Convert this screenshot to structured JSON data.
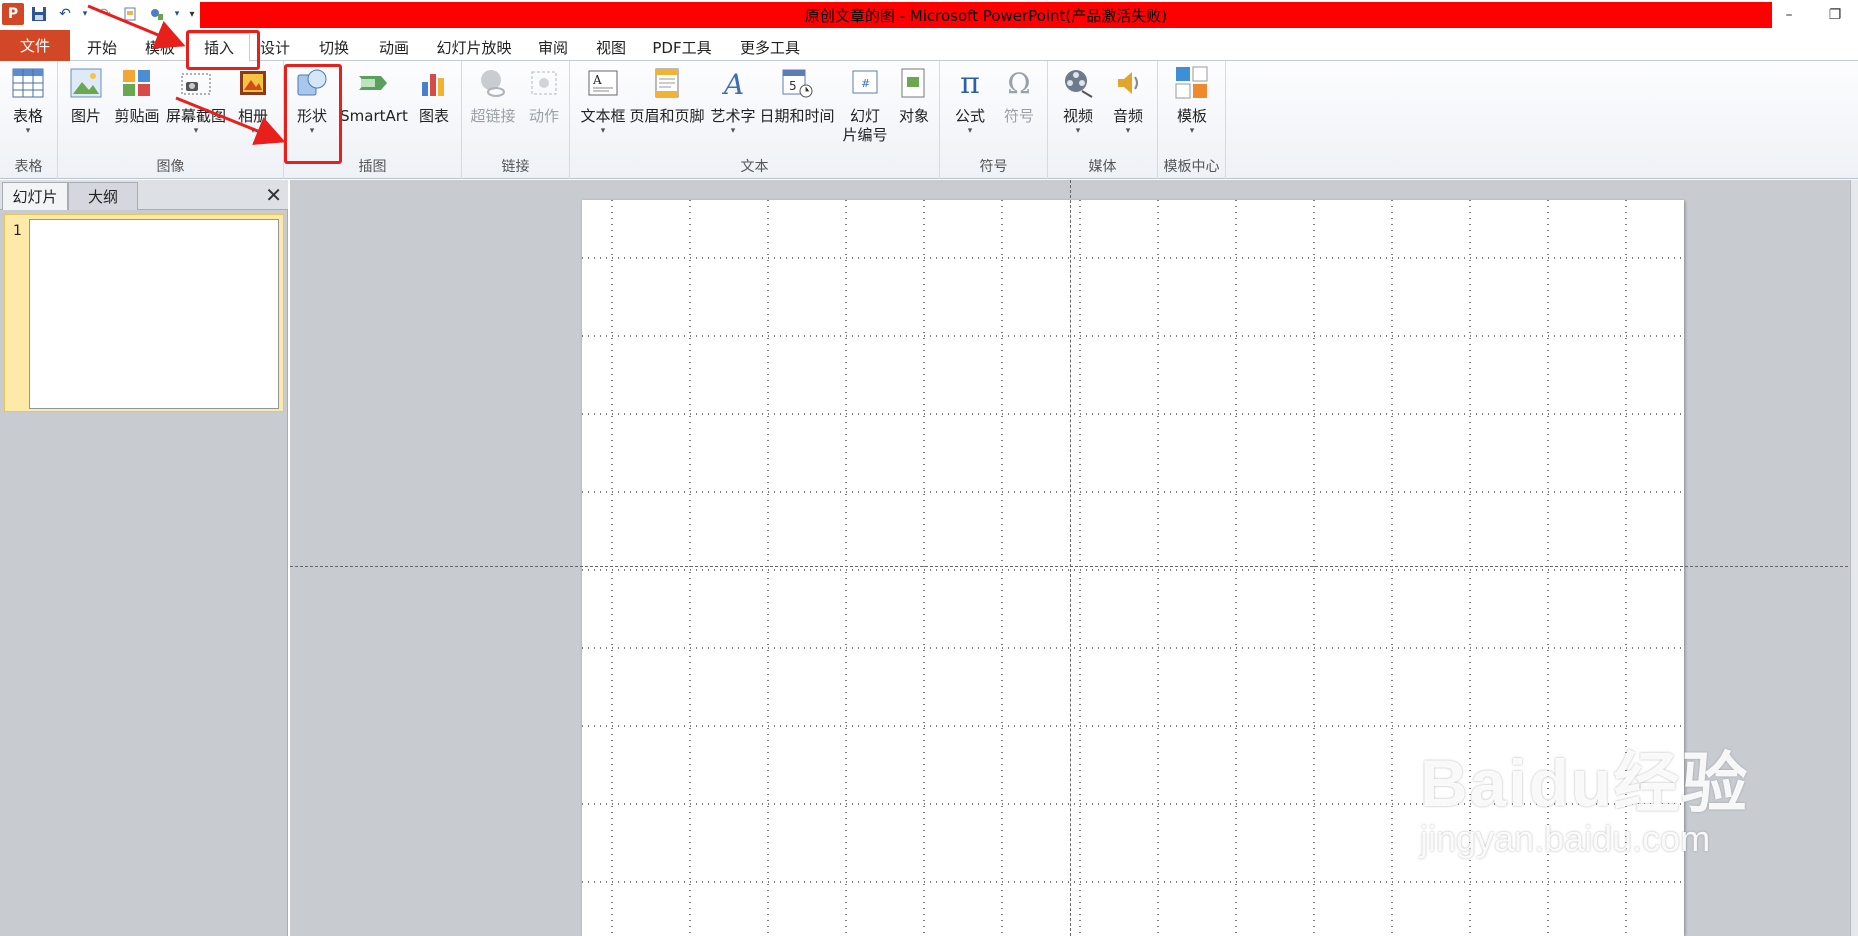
{
  "titlebar": {
    "title": "原创文章的图 - Microsoft PowerPoint(产品激活失败)",
    "app_letter": "P",
    "minimize": "–",
    "restore": "❐"
  },
  "tabs": {
    "file": "文件",
    "home": "开始",
    "template": "模板",
    "insert": "插入",
    "design": "设计",
    "transitions": "切换",
    "animations": "动画",
    "slideshow": "幻灯片放映",
    "review": "审阅",
    "view": "视图",
    "pdf": "PDF工具",
    "more": "更多工具"
  },
  "ribbon": {
    "groups": {
      "tables": "表格",
      "images": "图像",
      "illustrations": "插图",
      "links": "链接",
      "text": "文本",
      "symbols": "符号",
      "media": "媒体",
      "template_center": "模板中心"
    },
    "buttons": {
      "table": "表格",
      "picture": "图片",
      "clipart": "剪贴画",
      "screenshot": "屏幕截图",
      "album": "相册",
      "shapes": "形状",
      "smartart": "SmartArt",
      "chart": "图表",
      "hyperlink": "超链接",
      "action": "动作",
      "textbox": "文本框",
      "header_footer": "页眉和页脚",
      "wordart": "艺术字",
      "datetime": "日期和时间",
      "slide_number_1": "幻灯",
      "slide_number_2": "片编号",
      "object": "对象",
      "equation": "公式",
      "symbol": "符号",
      "video": "视频",
      "audio": "音频",
      "template": "模板"
    },
    "dropdown_glyph": "▾"
  },
  "leftpane": {
    "tab_slides": "幻灯片",
    "tab_outline": "大纲",
    "close": "✕",
    "slide_number": "1"
  },
  "watermark": {
    "brand": "Baidu经验",
    "url": "jingyan.baidu.com"
  },
  "colors": {
    "title_bar": "#ff0000",
    "file_tab": "#d24726",
    "highlight": "#e8201c",
    "editor_bg": "#c8ccd1"
  }
}
